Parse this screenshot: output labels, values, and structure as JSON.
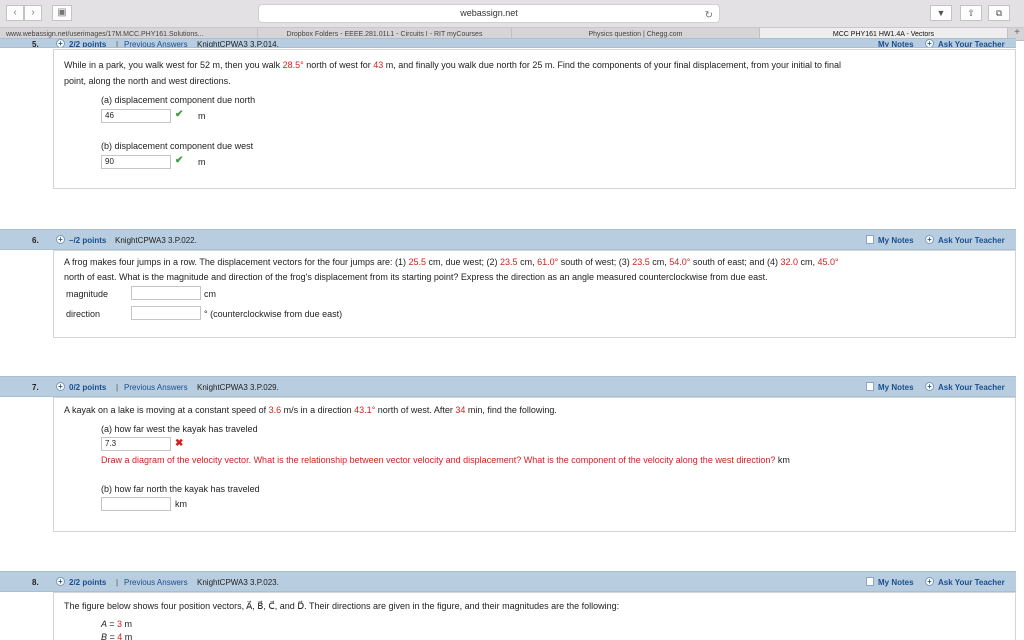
{
  "browser": {
    "address": "webassign.net",
    "tabs": [
      "www.webassign.net/userimages/17M.MCC.PHY161.Solutions...",
      "Dropbox Folders - EEEE.281.01L1 - Circuits I - RIT myCourses",
      "Physics question | Chegg.com",
      "MCC PHY161 HW1.4A - Vectors"
    ]
  },
  "q5": {
    "num": "5.",
    "points": "2/2 points",
    "sep": "|",
    "prev": "Previous Answers",
    "source": "KnightCPWA3 3.P.014.",
    "notes": "My Notes",
    "ask": "Ask Your Teacher",
    "line1a": "While in a park, you walk west for 52 m, then you walk ",
    "angle": "28.5°",
    "line1b": " north of west for ",
    "dist": "43",
    "line1c": " m, and finally you walk due north for 25 m. Find the components of your final displacement, from your initial to final",
    "line2": "point, along the north and west directions.",
    "partA": "(a) displacement component due north",
    "answerA": "46",
    "unitA": "m",
    "partB": "(b) displacement component due west",
    "answerB": "90",
    "unitB": "m"
  },
  "q6": {
    "num": "6.",
    "points": "–/2 points",
    "source": "KnightCPWA3 3.P.022.",
    "notes": "My Notes",
    "ask": "Ask Your Teacher",
    "t1": "A frog makes four jumps in a row. The displacement vectors for the four jumps are: (1) ",
    "v1": "25.5",
    "t2": " cm, due west; (2) ",
    "v2": "23.5",
    "t3": " cm, ",
    "v3": "61.0°",
    "t4": " south of west; (3) ",
    "v4": "23.5",
    "t5": " cm, ",
    "v5": "54.0°",
    "t6": " south of east; and (4) ",
    "v6": "32.0",
    "t7": " cm, ",
    "v7": "45.0°",
    "line2": "north of east. What is the magnitude and direction of the frog's displacement from its starting point? Express the direction as an angle measured counterclockwise from due east.",
    "magLabel": "magnitude",
    "magUnit": "cm",
    "dirLabel": "direction",
    "dirUnit": "° (counterclockwise from due east)"
  },
  "q7": {
    "num": "7.",
    "points": "0/2 points",
    "sep": "|",
    "prev": "Previous Answers",
    "source": "KnightCPWA3 3.P.029.",
    "notes": "My Notes",
    "ask": "Ask Your Teacher",
    "t1": "A kayak on a lake is moving at a constant speed of ",
    "speed": "3.6",
    "t2": " m/s in a direction ",
    "angle": "43.1°",
    "t3": " north of west. After ",
    "time": "34",
    "t4": " min, find the following.",
    "partA": "(a) how far west the kayak has traveled",
    "answerA": "7.3",
    "feedback": "Draw a diagram of the velocity vector. What is the relationship between vector velocity and displacement? What is the component of the velocity along the west direction?",
    "unitA": "km",
    "partB": "(b) how far north the kayak has traveled",
    "unitB": "km"
  },
  "q8": {
    "num": "8.",
    "points": "2/2 points",
    "sep": "|",
    "prev": "Previous Answers",
    "source": "KnightCPWA3 3.P.023.",
    "notes": "My Notes",
    "ask": "Ask Your Teacher",
    "line1": "The figure below shows four position vectors, A⃗, B⃗, C⃗, and D⃗. Their directions are given in the figure, and their magnitudes are the following:",
    "magA": "A = ",
    "magAval": "3",
    "magAunit": " m",
    "magB": "B = ",
    "magBval": "4",
    "magBunit": " m"
  }
}
